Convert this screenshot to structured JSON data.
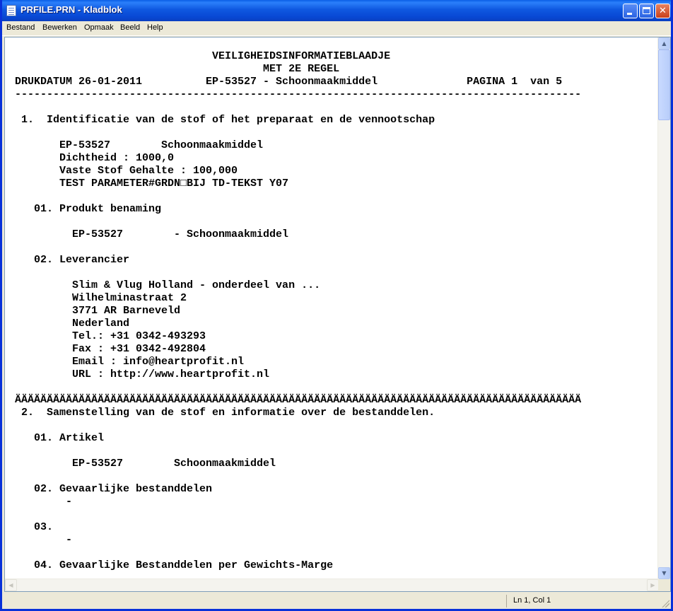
{
  "window": {
    "title": "PRFILE.PRN - Kladblok"
  },
  "menu": [
    {
      "label": "Bestand"
    },
    {
      "label": "Bewerken"
    },
    {
      "label": "Opmaak"
    },
    {
      "label": "Beeld"
    },
    {
      "label": "Help"
    }
  ],
  "document": {
    "lines": [
      "                               VEILIGHEIDSINFORMATIEBLAADJE",
      "                                       MET 2E REGEL",
      "DRUKDATUM 26-01-2011          EP-53527 - Schoonmaakmiddel              PAGINA 1  van 5",
      "-----------------------------------------------------------------------------------------",
      "",
      " 1.  Identificatie van de stof of het preparaat en de vennootschap",
      "",
      "       EP-53527        Schoonmaakmiddel",
      "       Dichtheid : 1000,0",
      "       Vaste Stof Gehalte : 100,000",
      "       TEST PARAMETER#GRDN□BIJ TD-TEKST Y07",
      "",
      "   01. Produkt benaming",
      "",
      "         EP-53527        - Schoonmaakmiddel",
      "",
      "   02. Leverancier",
      "",
      "         Slim & Vlug Holland - onderdeel van ...",
      "         Wilhelminastraat 2",
      "         3771 AR Barneveld",
      "         Nederland",
      "         Tel.: +31 0342-493293",
      "         Fax : +31 0342-492804",
      "         Email : info@heartprofit.nl",
      "         URL : http://www.heartprofit.nl",
      "",
      "ÄÄÄÄÄÄÄÄÄÄÄÄÄÄÄÄÄÄÄÄÄÄÄÄÄÄÄÄÄÄÄÄÄÄÄÄÄÄÄÄÄÄÄÄÄÄÄÄÄÄÄÄÄÄÄÄÄÄÄÄÄÄÄÄÄÄÄÄÄÄÄÄÄÄÄÄÄÄÄÄÄÄÄÄÄÄÄÄÄ",
      " 2.  Samenstelling van de stof en informatie over de bestanddelen.",
      "",
      "   01. Artikel",
      "",
      "         EP-53527        Schoonmaakmiddel",
      "",
      "   02. Gevaarlijke bestanddelen",
      "        -",
      "",
      "   03.",
      "        -",
      "",
      "   04. Gevaarlijke Bestanddelen per Gewichts-Marge"
    ]
  },
  "status": {
    "position": "Ln 1, Col 1"
  }
}
